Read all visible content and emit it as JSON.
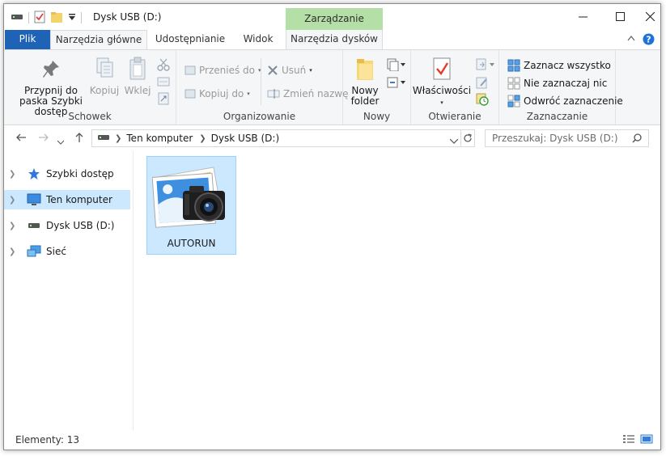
{
  "window": {
    "title": "Dysk USB (D:)",
    "context_header": "Zarządzanie",
    "controls": {
      "minimize": "—",
      "maximize": "☐",
      "close": "✕"
    }
  },
  "tabs": [
    {
      "label": "Plik"
    },
    {
      "label": "Narzędzia główne"
    },
    {
      "label": "Udostępnianie"
    },
    {
      "label": "Widok"
    },
    {
      "label": "Narzędzia dysków"
    }
  ],
  "ribbon": {
    "schowek": {
      "label": "Schowek",
      "pin": "Przypnij do paska Szybki dostęp",
      "copy": "Kopiuj",
      "paste": "Wklej"
    },
    "organizuj": {
      "label": "Organizowanie",
      "move_to": "Przenieś do",
      "copy_to": "Kopiuj do",
      "delete": "Usuń",
      "rename": "Zmień nazwę"
    },
    "nowy": {
      "label": "Nowy",
      "new_folder": "Nowy folder"
    },
    "otwieranie": {
      "label": "Otwieranie",
      "properties": "Właściwości"
    },
    "zaznaczanie": {
      "label": "Zaznaczanie",
      "select_all": "Zaznacz wszystko",
      "select_none": "Nie zaznaczaj nic",
      "invert": "Odwróć zaznaczenie"
    }
  },
  "address": {
    "crumbs": [
      "Ten komputer",
      "Dysk USB (D:)"
    ],
    "search_placeholder": "Przeszukaj: Dysk USB (D:)"
  },
  "nav": {
    "items": [
      {
        "label": "Szybki dostęp",
        "icon": "star-icon"
      },
      {
        "label": "Ten komputer",
        "icon": "monitor-icon"
      },
      {
        "label": "Dysk USB (D:)",
        "icon": "usb-drive-icon"
      },
      {
        "label": "Sieć",
        "icon": "network-icon"
      }
    ]
  },
  "files": [
    {
      "name": "AUTORUN",
      "icon": "camera-photo-icon"
    }
  ],
  "status": {
    "items_count": "Elementy: 13"
  },
  "colors": {
    "file_tab": "#1e63b6",
    "context_tab": "#b4dfa6",
    "selection": "#cce8ff",
    "selection_border": "#99d1ff"
  }
}
